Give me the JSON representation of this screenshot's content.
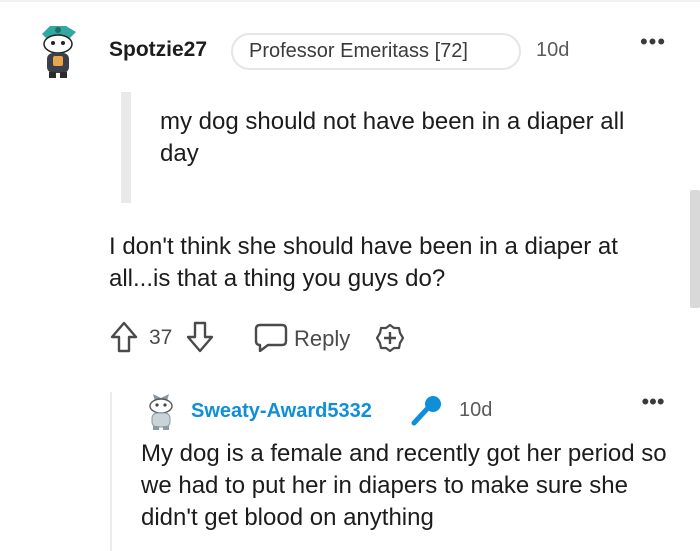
{
  "comment": {
    "username": "Spotzie27",
    "flair": "Professor Emeritass [72]",
    "timestamp": "10d",
    "more_label": "•••",
    "quote": "my dog should not have been in a diaper all day",
    "body": "I don't think she should have been in a diaper at all...is that a thing you guys do?",
    "vote_count": "37",
    "reply_label": "Reply"
  },
  "reply": {
    "username": "Sweaty-Award5332",
    "timestamp": "10d",
    "more_label": "•••",
    "body": "My dog is a female and recently got her period so we had to put her in diapers to make sure she didn't get blood on anything"
  },
  "colors": {
    "accent_blue": "#0f8fd9",
    "text": "#1c1c1c",
    "muted": "#5a5a5a"
  }
}
